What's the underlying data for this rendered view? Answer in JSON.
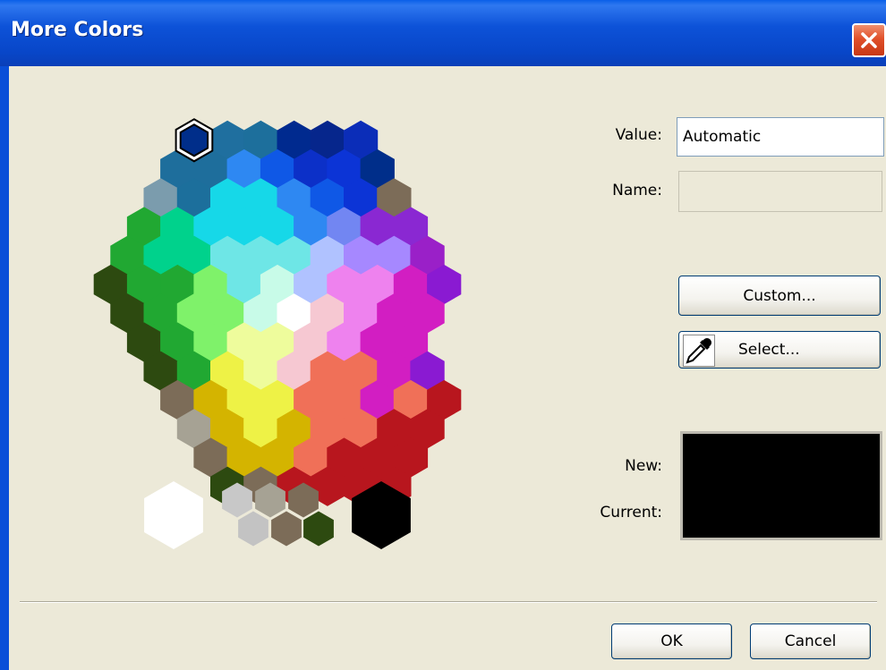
{
  "window": {
    "title": "More Colors"
  },
  "icons": {
    "close": "close-icon",
    "dropper": "eyedropper-icon"
  },
  "colors": {
    "titlebar": "#0a52d8",
    "dialog_bg": "#ece9d8",
    "close_button": "#e0502a",
    "preview_new": "#000000",
    "preview_current": "#000000"
  },
  "fields": {
    "value_label": "Value:",
    "value": "Automatic",
    "name_label": "Name:",
    "name": ""
  },
  "buttons": {
    "custom": "Custom...",
    "select": "Select...",
    "ok": "OK",
    "cancel": "Cancel"
  },
  "preview": {
    "new_label": "New:",
    "current_label": "Current:"
  },
  "palette": {
    "selected_color": "#002e8a",
    "swatches": [
      {
        "q": 0,
        "r": -5,
        "c": "#002e8a"
      },
      {
        "q": 1,
        "r": -5,
        "c": "#1f6f9f"
      },
      {
        "q": 2,
        "r": -5,
        "c": "#1d6f9c"
      },
      {
        "q": 3,
        "r": -5,
        "c": "#002a8f"
      },
      {
        "q": 4,
        "r": -5,
        "c": "#06268c"
      },
      {
        "q": 5,
        "r": -5,
        "c": "#0b2db8"
      },
      {
        "q": -1,
        "r": -4,
        "c": "#1e6e9c"
      },
      {
        "q": 0,
        "r": -4,
        "c": "#1e6e9c"
      },
      {
        "q": 1,
        "r": -4,
        "c": "#2e88f2"
      },
      {
        "q": 2,
        "r": -4,
        "c": "#0f58e6"
      },
      {
        "q": 3,
        "r": -4,
        "c": "#0c30c8"
      },
      {
        "q": 4,
        "r": -4,
        "c": "#0c34d6"
      },
      {
        "q": 5,
        "r": -4,
        "c": "#002e8a"
      },
      {
        "q": -2,
        "r": -3,
        "c": "#7b9cad"
      },
      {
        "q": -1,
        "r": -3,
        "c": "#1c6f9c"
      },
      {
        "q": 0,
        "r": -3,
        "c": "#16d8e8"
      },
      {
        "q": 1,
        "r": -3,
        "c": "#16d8e8"
      },
      {
        "q": 2,
        "r": -3,
        "c": "#2e88f2"
      },
      {
        "q": 3,
        "r": -3,
        "c": "#0f58e6"
      },
      {
        "q": 4,
        "r": -3,
        "c": "#0c34d6"
      },
      {
        "q": 5,
        "r": -3,
        "c": "#7c6c58"
      },
      {
        "q": -3,
        "r": -2,
        "c": "#21a832"
      },
      {
        "q": -2,
        "r": -2,
        "c": "#00d28c"
      },
      {
        "q": -1,
        "r": -2,
        "c": "#16d8e8"
      },
      {
        "q": 0,
        "r": -2,
        "c": "#16d8e8"
      },
      {
        "q": 1,
        "r": -2,
        "c": "#16d8e8"
      },
      {
        "q": 2,
        "r": -2,
        "c": "#2e88f2"
      },
      {
        "q": 3,
        "r": -2,
        "c": "#7286f2"
      },
      {
        "q": 4,
        "r": -2,
        "c": "#8a28d2"
      },
      {
        "q": 5,
        "r": -2,
        "c": "#8a28d2"
      },
      {
        "q": -4,
        "r": -1,
        "c": "#21a832"
      },
      {
        "q": -3,
        "r": -1,
        "c": "#00d28c"
      },
      {
        "q": -2,
        "r": -1,
        "c": "#00d28c"
      },
      {
        "q": -1,
        "r": -1,
        "c": "#6ee6e6"
      },
      {
        "q": 0,
        "r": -1,
        "c": "#6ee6e6"
      },
      {
        "q": 1,
        "r": -1,
        "c": "#6ee6e6"
      },
      {
        "q": 2,
        "r": -1,
        "c": "#b0c2ff"
      },
      {
        "q": 3,
        "r": -1,
        "c": "#a688ff"
      },
      {
        "q": 4,
        "r": -1,
        "c": "#a688ff"
      },
      {
        "q": 5,
        "r": -1,
        "c": "#9a20c8"
      },
      {
        "q": -5,
        "r": 0,
        "c": "#2d4a10"
      },
      {
        "q": -4,
        "r": 0,
        "c": "#21a832"
      },
      {
        "q": -3,
        "r": 0,
        "c": "#21a832"
      },
      {
        "q": -2,
        "r": 0,
        "c": "#7ff26a"
      },
      {
        "q": -1,
        "r": 0,
        "c": "#6ee6e6"
      },
      {
        "q": 0,
        "r": 0,
        "c": "#c8fbe8"
      },
      {
        "q": 1,
        "r": 0,
        "c": "#b0c2ff"
      },
      {
        "q": 2,
        "r": 0,
        "c": "#ee82ee"
      },
      {
        "q": 3,
        "r": 0,
        "c": "#ee82ee"
      },
      {
        "q": 4,
        "r": 0,
        "c": "#d21ec2"
      },
      {
        "q": 5,
        "r": 0,
        "c": "#8a1ad2"
      },
      {
        "q": -5,
        "r": 1,
        "c": "#2d4a10"
      },
      {
        "q": -4,
        "r": 1,
        "c": "#21a832"
      },
      {
        "q": -3,
        "r": 1,
        "c": "#7ff26a"
      },
      {
        "q": -2,
        "r": 1,
        "c": "#7ff26a"
      },
      {
        "q": -1,
        "r": 1,
        "c": "#c8fbe8"
      },
      {
        "q": 0,
        "r": 1,
        "c": "#ffffff"
      },
      {
        "q": 1,
        "r": 1,
        "c": "#f6c8d2"
      },
      {
        "q": 2,
        "r": 1,
        "c": "#ee82ee"
      },
      {
        "q": 3,
        "r": 1,
        "c": "#d21ec2"
      },
      {
        "q": 4,
        "r": 1,
        "c": "#d21ec2"
      },
      {
        "q": -5,
        "r": 2,
        "c": "#2d4a10"
      },
      {
        "q": -4,
        "r": 2,
        "c": "#21a832"
      },
      {
        "q": -3,
        "r": 2,
        "c": "#7ff26a"
      },
      {
        "q": -2,
        "r": 2,
        "c": "#eefc9c"
      },
      {
        "q": -1,
        "r": 2,
        "c": "#eefc9c"
      },
      {
        "q": 0,
        "r": 2,
        "c": "#f6c8d2"
      },
      {
        "q": 1,
        "r": 2,
        "c": "#ee82ee"
      },
      {
        "q": 2,
        "r": 2,
        "c": "#d21ec2"
      },
      {
        "q": 3,
        "r": 2,
        "c": "#d21ec2"
      },
      {
        "q": -5,
        "r": 3,
        "c": "#2d4a10"
      },
      {
        "q": -4,
        "r": 3,
        "c": "#21a832"
      },
      {
        "q": -3,
        "r": 3,
        "c": "#eef246"
      },
      {
        "q": -2,
        "r": 3,
        "c": "#eefc9c"
      },
      {
        "q": -1,
        "r": 3,
        "c": "#f6c8d2"
      },
      {
        "q": 0,
        "r": 3,
        "c": "#f07058"
      },
      {
        "q": 1,
        "r": 3,
        "c": "#f07058"
      },
      {
        "q": 2,
        "r": 3,
        "c": "#d21ec2"
      },
      {
        "q": 3,
        "r": 3,
        "c": "#8a1ad2"
      },
      {
        "q": -5,
        "r": 4,
        "c": "#7c6c58"
      },
      {
        "q": -4,
        "r": 4,
        "c": "#d4b400"
      },
      {
        "q": -3,
        "r": 4,
        "c": "#eef246"
      },
      {
        "q": -2,
        "r": 4,
        "c": "#eef246"
      },
      {
        "q": -1,
        "r": 4,
        "c": "#f07058"
      },
      {
        "q": 0,
        "r": 4,
        "c": "#f07058"
      },
      {
        "q": 1,
        "r": 4,
        "c": "#d21ec2"
      },
      {
        "q": 2,
        "r": 4,
        "c": "#f07058"
      },
      {
        "q": 3,
        "r": 4,
        "c": "#b8161e"
      },
      {
        "q": -5,
        "r": 5,
        "c": "#a6a294"
      },
      {
        "q": -4,
        "r": 5,
        "c": "#d4b400"
      },
      {
        "q": -3,
        "r": 5,
        "c": "#eef246"
      },
      {
        "q": -2,
        "r": 5,
        "c": "#d4b400"
      },
      {
        "q": -1,
        "r": 5,
        "c": "#f07058"
      },
      {
        "q": 0,
        "r": 5,
        "c": "#f07058"
      },
      {
        "q": 1,
        "r": 5,
        "c": "#b8161e"
      },
      {
        "q": 2,
        "r": 5,
        "c": "#b8161e"
      },
      {
        "q": -5,
        "r": 6,
        "c": "#7c6c58"
      },
      {
        "q": -4,
        "r": 6,
        "c": "#d4b400"
      },
      {
        "q": -3,
        "r": 6,
        "c": "#d4b400"
      },
      {
        "q": -2,
        "r": 6,
        "c": "#f07058"
      },
      {
        "q": -1,
        "r": 6,
        "c": "#b8161e"
      },
      {
        "q": 0,
        "r": 6,
        "c": "#b8161e"
      },
      {
        "q": 1,
        "r": 6,
        "c": "#b8161e"
      },
      {
        "q": -5,
        "r": 7,
        "c": "#2d4a10"
      },
      {
        "q": -4,
        "r": 7,
        "c": "#7c6c58"
      },
      {
        "q": -3,
        "r": 7,
        "c": "#b8161e"
      },
      {
        "q": -2,
        "r": 7,
        "c": "#b8161e"
      },
      {
        "q": -1,
        "r": 7,
        "c": "#b8161e"
      },
      {
        "q": 0,
        "r": 7,
        "c": "#b8161e"
      }
    ],
    "gray_swatches": [
      "#ffffff",
      "#c8c8c8",
      "#a6a294",
      "#c3c3c3",
      "#7c6c58",
      "#7c6c58",
      "#2d4a10",
      "#000000"
    ]
  }
}
